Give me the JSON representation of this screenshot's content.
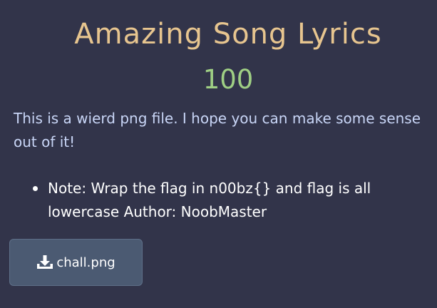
{
  "challenge": {
    "title": "Amazing Song Lyrics",
    "value": "100",
    "description": "This is a wierd png file. I hope you can make some sense out of it!",
    "notes": [
      "Note: Wrap the flag in n00bz{} and flag is all lowercase Author: NoobMaster"
    ],
    "file": {
      "label": "chall.png",
      "icon": "download-icon"
    }
  },
  "colors": {
    "background": "#32344a",
    "title": "#e7c58f",
    "value": "#9fcf84",
    "description": "#c9d6f7",
    "button": "#4b5a72"
  }
}
